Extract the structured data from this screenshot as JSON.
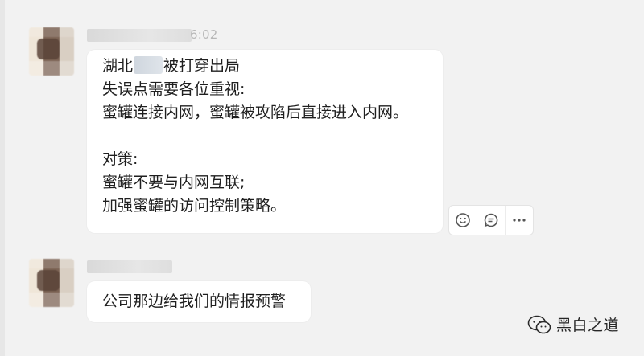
{
  "messages": [
    {
      "time": "6:02",
      "lines": {
        "l1_pre": "湖北",
        "l1_post": "被打穿出局",
        "l2": "失误点需要各位重视:",
        "l3": "蜜罐连接内网，蜜罐被攻陷后直接进入内网。",
        "l4": "",
        "l5": "对策:",
        "l6": "蜜罐不要与内网互联;",
        "l7": "加强蜜罐的访问控制策略。"
      },
      "actions": [
        "emoji-reaction-icon",
        "reply-comment-icon",
        "more-icon"
      ]
    },
    {
      "text": "公司那边给我们的情报预警"
    }
  ],
  "watermark": {
    "text": "黑白之道",
    "icon": "wechat-icon"
  },
  "colors": {
    "background": "#f2f2f2",
    "bubble": "#ffffff",
    "time": "#b7b7b7"
  }
}
